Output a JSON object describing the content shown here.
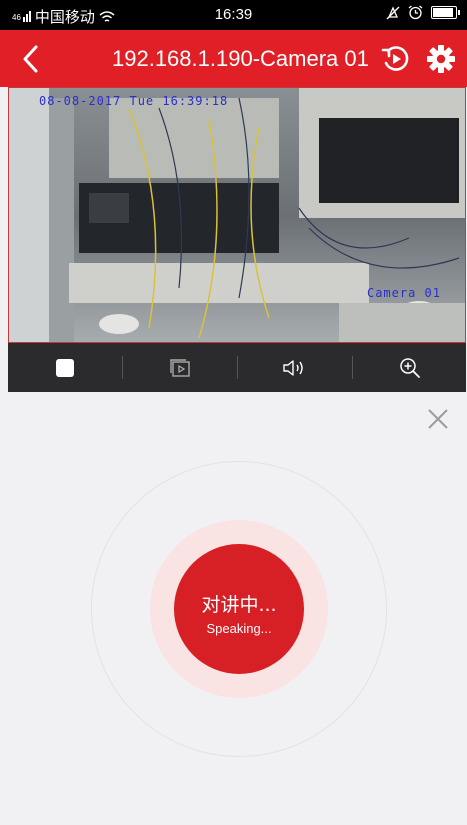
{
  "status_bar": {
    "signal": "46",
    "carrier": "中国移动",
    "time": "16:39",
    "battery_level": 0.9
  },
  "header": {
    "title": "192.168.1.190-Camera 01"
  },
  "video": {
    "osd_datetime": "08-08-2017 Tue 16:39:18",
    "osd_camera": "Camera 01"
  },
  "controls": [
    "stop-icon",
    "playback-icon",
    "volume-icon",
    "zoom-in-icon"
  ],
  "talk": {
    "label_cn": "对讲中...",
    "label_en": "Speaking..."
  },
  "colors": {
    "accent": "#e02026",
    "talk_button": "#d71f26",
    "talk_halo": "#fae3e3",
    "control_bar": "#2b2b2d",
    "panel_bg": "#f1f1f3"
  }
}
